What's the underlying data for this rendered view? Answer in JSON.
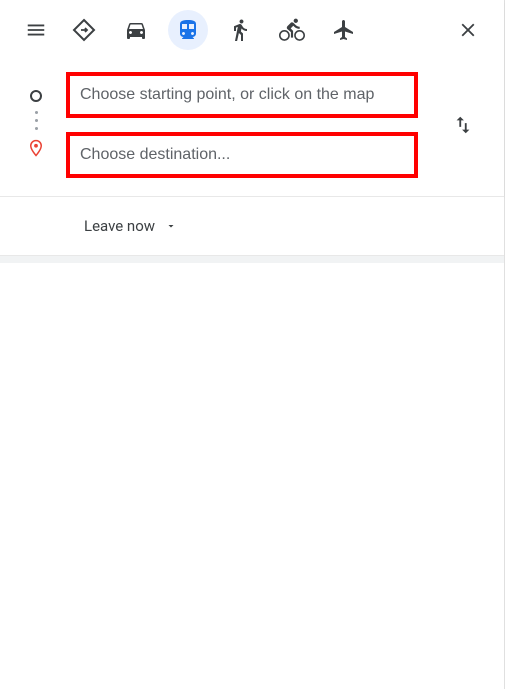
{
  "modes": {
    "best": "best",
    "driving": "driving",
    "transit": "transit",
    "walking": "walking",
    "cycling": "cycling",
    "flights": "flights",
    "active": "transit"
  },
  "inputs": {
    "origin_placeholder": "Choose starting point, or click on the map",
    "origin_value": "",
    "destination_placeholder": "Choose destination...",
    "destination_value": ""
  },
  "timing": {
    "label": "Leave now"
  }
}
